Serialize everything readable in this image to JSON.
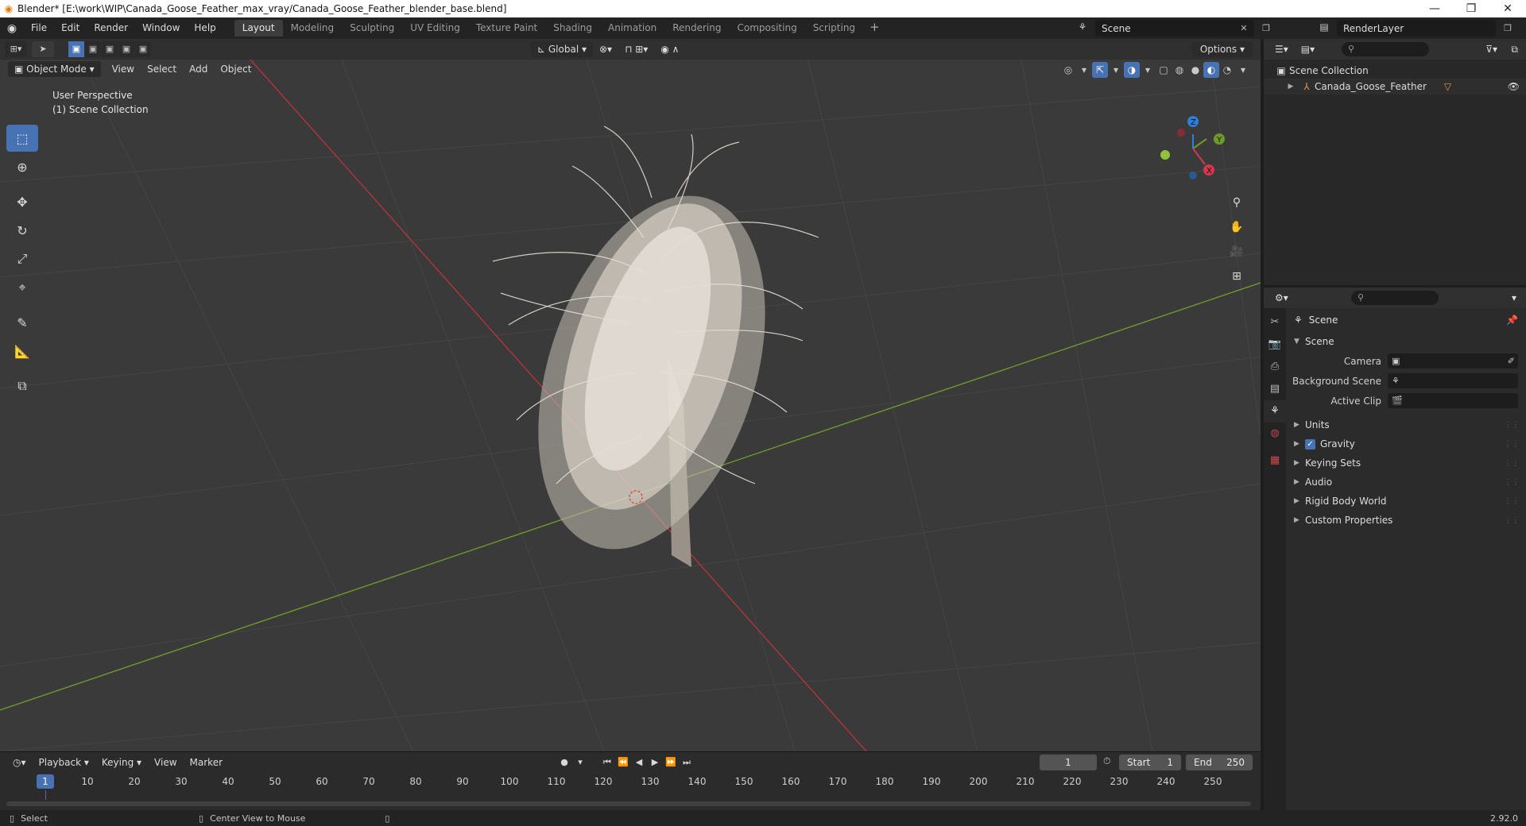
{
  "window": {
    "title": "Blender* [E:\\work\\WIP\\Canada_Goose_Feather_max_vray/Canada_Goose_Feather_blender_base.blend]",
    "minimize": "—",
    "maximize": "❐",
    "close": "✕"
  },
  "menu": {
    "items": [
      "File",
      "Edit",
      "Render",
      "Window",
      "Help"
    ],
    "workspaces": [
      "Layout",
      "Modeling",
      "Sculpting",
      "UV Editing",
      "Texture Paint",
      "Shading",
      "Animation",
      "Rendering",
      "Compositing",
      "Scripting"
    ],
    "active_workspace": "Layout",
    "add": "+",
    "scene": "Scene",
    "render_layer": "RenderLayer"
  },
  "viewport": {
    "mode": "Object Mode",
    "menus": [
      "View",
      "Select",
      "Add",
      "Object"
    ],
    "transform_orientation": "Global",
    "options": "Options",
    "perspective": "User Perspective",
    "collection": "(1) Scene Collection",
    "gizmo": {
      "x": "X",
      "y": "Y",
      "z": "Z"
    }
  },
  "timeline": {
    "menus": [
      "Playback",
      "Keying",
      "View",
      "Marker"
    ],
    "current_frame": "1",
    "start_label": "Start",
    "start": "1",
    "end_label": "End",
    "end": "250",
    "ticks": [
      "1",
      "10",
      "20",
      "30",
      "40",
      "50",
      "60",
      "70",
      "80",
      "90",
      "100",
      "110",
      "120",
      "130",
      "140",
      "150",
      "160",
      "170",
      "180",
      "190",
      "200",
      "210",
      "220",
      "230",
      "240",
      "250"
    ]
  },
  "status": {
    "left": "Select",
    "middle": "Center View to Mouse",
    "version": "2.92.0"
  },
  "outliner": {
    "root": "Scene Collection",
    "item": "Canada_Goose_Feather"
  },
  "properties": {
    "title": "Scene",
    "panel": "Scene",
    "camera_label": "Camera",
    "bg_scene_label": "Background Scene",
    "active_clip_label": "Active Clip",
    "sections": [
      "Units",
      "Gravity",
      "Keying Sets",
      "Audio",
      "Rigid Body World",
      "Custom Properties"
    ]
  },
  "colors": {
    "accent": "#4772b3",
    "x_axis": "#b3333c",
    "y_axis": "#6e9a2a",
    "z_axis": "#2f7ed8"
  }
}
